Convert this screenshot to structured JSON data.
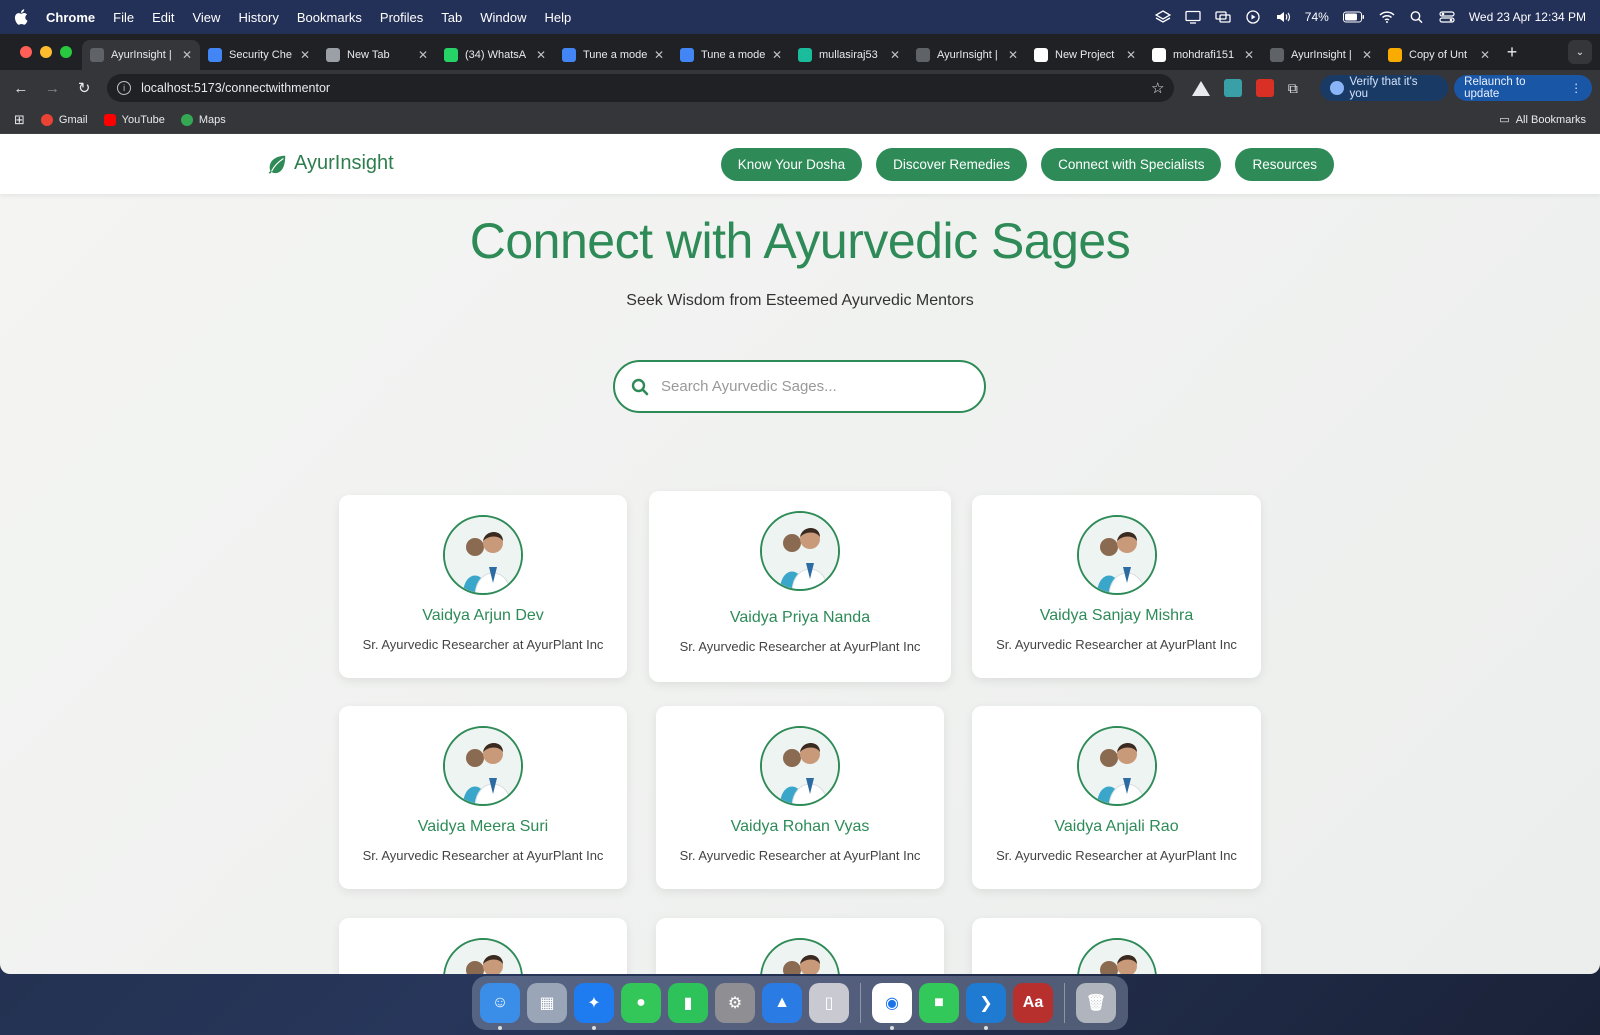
{
  "menubar": {
    "app": "Chrome",
    "items": [
      "File",
      "Edit",
      "View",
      "History",
      "Bookmarks",
      "Profiles",
      "Tab",
      "Window",
      "Help"
    ],
    "battery": "74%",
    "datetime": "Wed 23 Apr  12:34 PM"
  },
  "browser": {
    "tabs": [
      {
        "title": "AyurInsight |",
        "color": "#5f6368"
      },
      {
        "title": "Security Che",
        "color": "#4285f4"
      },
      {
        "title": "New Tab",
        "color": "#9aa0a6"
      },
      {
        "title": "(34) WhatsA",
        "color": "#25d366"
      },
      {
        "title": "Tune a mode",
        "color": "#4285f4"
      },
      {
        "title": "Tune a mode",
        "color": "#4285f4"
      },
      {
        "title": "mullasiraj53",
        "color": "#1abc9c"
      },
      {
        "title": "AyurInsight |",
        "color": "#5f6368"
      },
      {
        "title": "New Project",
        "color": "#ffffff"
      },
      {
        "title": "mohdrafi151",
        "color": "#ffffff"
      },
      {
        "title": "AyurInsight |",
        "color": "#5f6368"
      },
      {
        "title": "Copy of Unt",
        "color": "#f9ab00"
      }
    ],
    "url": "localhost:5173/connectwithmentor",
    "verify_label": "Verify that it's you",
    "relaunch_label": "Relaunch to update",
    "bookmarks": [
      {
        "label": "Gmail",
        "color": "#ea4335"
      },
      {
        "label": "YouTube",
        "color": "#ff0000"
      },
      {
        "label": "Maps",
        "color": "#34a853"
      }
    ],
    "all_bookmarks": "All Bookmarks"
  },
  "site": {
    "brand": "AyurInsight",
    "nav": [
      "Know Your Dosha",
      "Discover Remedies",
      "Connect with Specialists",
      "Resources"
    ],
    "title": "Connect with Ayurvedic Sages",
    "subtitle": "Seek Wisdom from Esteemed Ayurvedic Mentors",
    "search_placeholder": "Search Ayurvedic Sages...",
    "mentors": [
      {
        "name": "Vaidya Arjun Dev",
        "role": "Sr. Ayurvedic Researcher at AyurPlant Inc"
      },
      {
        "name": "Vaidya Priya Nanda",
        "role": "Sr. Ayurvedic Researcher at AyurPlant Inc"
      },
      {
        "name": "Vaidya Sanjay Mishra",
        "role": "Sr. Ayurvedic Researcher at AyurPlant Inc"
      },
      {
        "name": "Vaidya Meera Suri",
        "role": "Sr. Ayurvedic Researcher at AyurPlant Inc"
      },
      {
        "name": "Vaidya Rohan Vyas",
        "role": "Sr. Ayurvedic Researcher at AyurPlant Inc"
      },
      {
        "name": "Vaidya Anjali Rao",
        "role": "Sr. Ayurvedic Researcher at AyurPlant Inc"
      }
    ],
    "accent": "#2e8b57"
  },
  "dock": [
    {
      "name": "finder-icon",
      "color": "#3b8ee8",
      "glyph": "☺"
    },
    {
      "name": "launchpad-icon",
      "color": "#9aa5b8",
      "glyph": "▦"
    },
    {
      "name": "safari-icon",
      "color": "#1e7cf0",
      "glyph": "✦"
    },
    {
      "name": "messages-icon",
      "color": "#33c759",
      "glyph": "●"
    },
    {
      "name": "numbers-icon",
      "color": "#2ec35a",
      "glyph": "▮"
    },
    {
      "name": "system-settings-icon",
      "color": "#8e8e93",
      "glyph": "⚙"
    },
    {
      "name": "keynote-icon",
      "color": "#2a7be4",
      "glyph": "▲"
    },
    {
      "name": "preview-icon",
      "color": "#c9c9d1",
      "glyph": "▯"
    },
    {
      "name": "chrome-icon",
      "color": "#ffffff",
      "glyph": "◉"
    },
    {
      "name": "facetime-icon",
      "color": "#32c85a",
      "glyph": "■"
    },
    {
      "name": "vscode-icon",
      "color": "#1f7ad1",
      "glyph": "❯"
    },
    {
      "name": "dictionary-icon",
      "color": "#b8302e",
      "glyph": "Aa"
    },
    {
      "name": "trash-icon",
      "color": "#b0b4bc",
      "glyph": "🗑"
    }
  ]
}
